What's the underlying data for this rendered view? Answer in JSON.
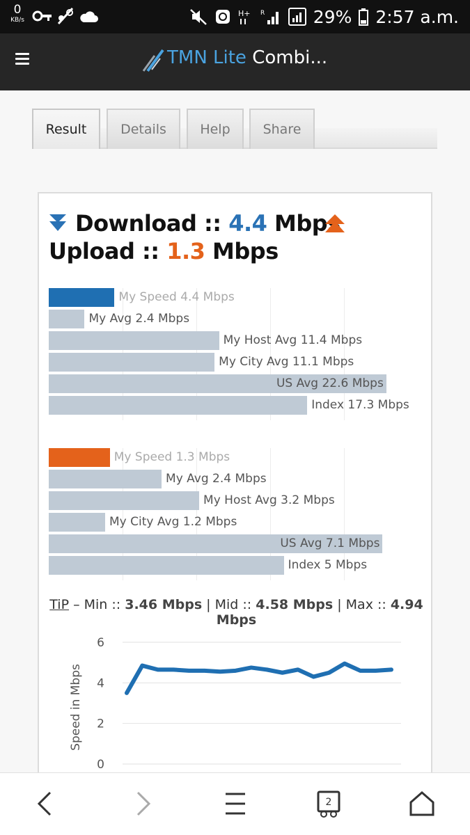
{
  "status_bar": {
    "net_speed": "0",
    "net_unit": "KB/s",
    "battery": "29%",
    "time": "2:57 a.m."
  },
  "app_bar": {
    "title_brand": "TMN Lite",
    "title_rest": " Combi..."
  },
  "tabs": [
    {
      "label": "Result",
      "active": true
    },
    {
      "label": "Details",
      "active": false
    },
    {
      "label": "Help",
      "active": false
    },
    {
      "label": "Share",
      "active": false
    }
  ],
  "summary": {
    "download_label": "Download :: ",
    "download_value": "4.4",
    "download_unit": " Mbps",
    "upload_label": "Upload :: ",
    "upload_value": "1.3",
    "upload_unit": " Mbps"
  },
  "chart_data": [
    {
      "type": "bar",
      "orientation": "horizontal",
      "unit": "Mbps",
      "categories": [
        "My Speed",
        "My Avg",
        "My Host Avg",
        "My City Avg",
        "US Avg",
        "Index"
      ],
      "values": [
        4.4,
        2.4,
        11.4,
        11.1,
        22.6,
        17.3
      ],
      "labels": [
        "My Speed 4.4 Mbps",
        "My Avg 2.4 Mbps",
        "My Host Avg 11.4 Mbps",
        "My City Avg 11.1 Mbps",
        "US Avg 22.6 Mbps",
        "Index 17.3 Mbps"
      ],
      "highlight_color": "#1f6fb2",
      "bar_color": "#bfcad5"
    },
    {
      "type": "bar",
      "orientation": "horizontal",
      "unit": "Mbps",
      "categories": [
        "My Speed",
        "My Avg",
        "My Host Avg",
        "My City Avg",
        "US Avg",
        "Index"
      ],
      "values": [
        1.3,
        2.4,
        3.2,
        1.2,
        7.1,
        5
      ],
      "labels": [
        "My Speed 1.3 Mbps",
        "My Avg 2.4 Mbps",
        "My Host Avg 3.2 Mbps",
        "My City Avg 1.2 Mbps",
        "US Avg 7.1 Mbps",
        "Index 5 Mbps"
      ],
      "highlight_color": "#e4621b",
      "bar_color": "#bfcad5"
    },
    {
      "type": "line",
      "ylabel": "Speed in Mbps",
      "ylim": [
        0,
        6
      ],
      "yticks": [
        "0",
        "2",
        "4",
        "6"
      ],
      "grid": true,
      "series": [
        {
          "values": [
            3.5,
            4.85,
            4.65,
            4.65,
            4.6,
            4.6,
            4.55,
            4.6,
            4.75,
            4.65,
            4.5,
            4.65,
            4.3,
            4.5,
            4.95,
            4.6,
            4.6,
            4.65
          ],
          "color": "#1f6fb2"
        }
      ]
    }
  ],
  "tip": {
    "tip_word": "TiP",
    "min_label": " – Min :: ",
    "min_value": "3.46 Mbps",
    "mid_label": " | Mid :: ",
    "mid_value": "4.58 Mbps",
    "max_label": " | Max :: ",
    "max_value": "4.94 Mbps"
  }
}
